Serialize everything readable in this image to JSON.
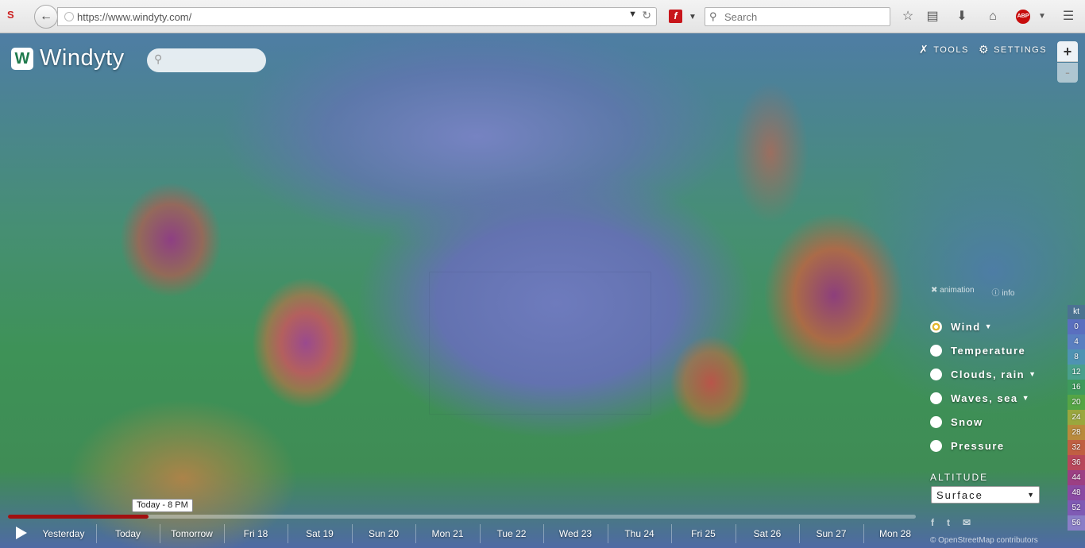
{
  "browser": {
    "url": "https://www.windyty.com/",
    "search_placeholder": "Search",
    "abp_label": "ABP"
  },
  "app": {
    "logo_text": "Windyty",
    "tools_label": "TOOLS",
    "settings_label": "SETTINGS",
    "zoom_in_label": "+",
    "zoom_out_label": "-"
  },
  "overlay_links": {
    "animation": "animation",
    "info": "info"
  },
  "overlays": [
    {
      "label": "Wind",
      "selected": true,
      "has_dropdown": true
    },
    {
      "label": "Temperature",
      "selected": false,
      "has_dropdown": false
    },
    {
      "label": "Clouds, rain",
      "selected": false,
      "has_dropdown": true
    },
    {
      "label": "Waves, sea",
      "selected": false,
      "has_dropdown": true
    },
    {
      "label": "Snow",
      "selected": false,
      "has_dropdown": false
    },
    {
      "label": "Pressure",
      "selected": false,
      "has_dropdown": false
    }
  ],
  "altitude": {
    "label": "ALTITUDE",
    "value": "Surface"
  },
  "legend": {
    "unit": "kt",
    "values": [
      "0",
      "4",
      "8",
      "12",
      "16",
      "20",
      "24",
      "28",
      "32",
      "36",
      "44",
      "48",
      "52",
      "56"
    ],
    "colors": [
      "#5a6fbf",
      "#5a7fc0",
      "#4f93b3",
      "#4aa08c",
      "#3e9a5c",
      "#55a545",
      "#9aa73e",
      "#b98a3c",
      "#c05f42",
      "#b8475b",
      "#9c3f83",
      "#8a4aa3",
      "#7f5ab4",
      "#8a7ec7"
    ]
  },
  "timeline": {
    "tooltip": "Today - 8 PM",
    "progress": 0.155,
    "days": [
      "Yesterday",
      "Today",
      "Tomorrow",
      "Fri 18",
      "Sat 19",
      "Sun 20",
      "Mon 21",
      "Tue 22",
      "Wed 23",
      "Thu 24",
      "Fri 25",
      "Sat 26",
      "Sun 27",
      "Mon 28"
    ]
  },
  "attribution": "© OpenStreetMap contributors",
  "social": [
    "f",
    "t",
    "chat"
  ]
}
